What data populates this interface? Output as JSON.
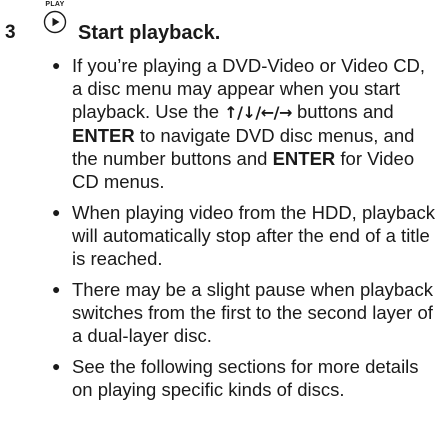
{
  "step": {
    "number": "3",
    "icon_caption": "PLAY",
    "icon": "play-button-icon",
    "title": "Start playback."
  },
  "bullets": [
    {
      "segments": [
        {
          "text": "If you’re playing a DVD-Video or Video CD, a disc menu may appear when you start playback. Use the ",
          "style": "normal"
        },
        {
          "text": "↑/↓/←/→",
          "style": "arrows"
        },
        {
          "text": " buttons and ",
          "style": "normal"
        },
        {
          "text": "ENTER",
          "style": "bold"
        },
        {
          "text": " to navigate DVD disc menus, and the number buttons and ",
          "style": "normal"
        },
        {
          "text": "ENTER",
          "style": "bold"
        },
        {
          "text": " for Video CD menus.",
          "style": "normal"
        }
      ]
    },
    {
      "segments": [
        {
          "text": "When playing video from the HDD, playback will automatically stop after the end of a title is reached.",
          "style": "normal"
        }
      ]
    },
    {
      "segments": [
        {
          "text": "There may be a slight pause when playback switches from the first to the second layer of a dual-layer disc.",
          "style": "normal"
        }
      ]
    },
    {
      "segments": [
        {
          "text": "See the following sections for more details on playing specific kinds of discs.",
          "style": "normal"
        }
      ]
    }
  ]
}
